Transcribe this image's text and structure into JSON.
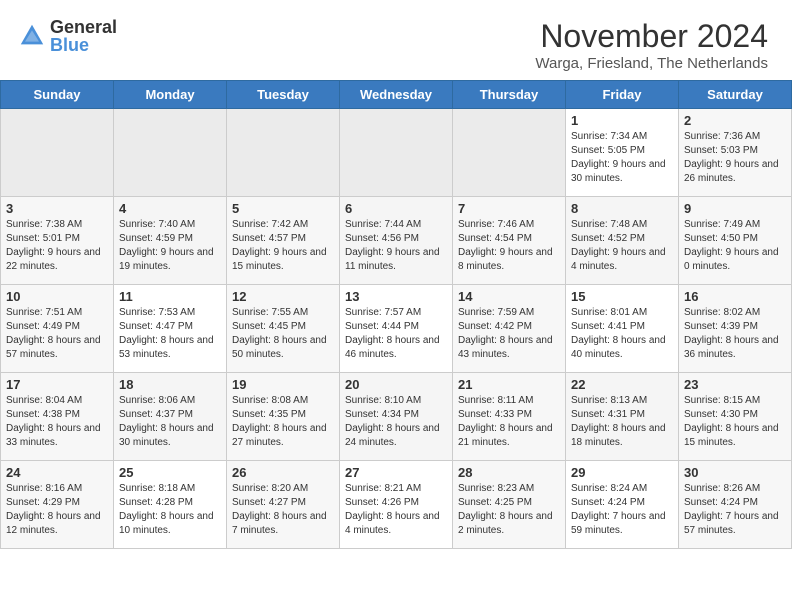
{
  "header": {
    "logo_general": "General",
    "logo_blue": "Blue",
    "title": "November 2024",
    "location": "Warga, Friesland, The Netherlands"
  },
  "days_of_week": [
    "Sunday",
    "Monday",
    "Tuesday",
    "Wednesday",
    "Thursday",
    "Friday",
    "Saturday"
  ],
  "weeks": [
    {
      "days": [
        {
          "num": "",
          "info": ""
        },
        {
          "num": "",
          "info": ""
        },
        {
          "num": "",
          "info": ""
        },
        {
          "num": "",
          "info": ""
        },
        {
          "num": "",
          "info": ""
        },
        {
          "num": "1",
          "info": "Sunrise: 7:34 AM\nSunset: 5:05 PM\nDaylight: 9 hours and 30 minutes."
        },
        {
          "num": "2",
          "info": "Sunrise: 7:36 AM\nSunset: 5:03 PM\nDaylight: 9 hours and 26 minutes."
        }
      ]
    },
    {
      "days": [
        {
          "num": "3",
          "info": "Sunrise: 7:38 AM\nSunset: 5:01 PM\nDaylight: 9 hours and 22 minutes."
        },
        {
          "num": "4",
          "info": "Sunrise: 7:40 AM\nSunset: 4:59 PM\nDaylight: 9 hours and 19 minutes."
        },
        {
          "num": "5",
          "info": "Sunrise: 7:42 AM\nSunset: 4:57 PM\nDaylight: 9 hours and 15 minutes."
        },
        {
          "num": "6",
          "info": "Sunrise: 7:44 AM\nSunset: 4:56 PM\nDaylight: 9 hours and 11 minutes."
        },
        {
          "num": "7",
          "info": "Sunrise: 7:46 AM\nSunset: 4:54 PM\nDaylight: 9 hours and 8 minutes."
        },
        {
          "num": "8",
          "info": "Sunrise: 7:48 AM\nSunset: 4:52 PM\nDaylight: 9 hours and 4 minutes."
        },
        {
          "num": "9",
          "info": "Sunrise: 7:49 AM\nSunset: 4:50 PM\nDaylight: 9 hours and 0 minutes."
        }
      ]
    },
    {
      "days": [
        {
          "num": "10",
          "info": "Sunrise: 7:51 AM\nSunset: 4:49 PM\nDaylight: 8 hours and 57 minutes."
        },
        {
          "num": "11",
          "info": "Sunrise: 7:53 AM\nSunset: 4:47 PM\nDaylight: 8 hours and 53 minutes."
        },
        {
          "num": "12",
          "info": "Sunrise: 7:55 AM\nSunset: 4:45 PM\nDaylight: 8 hours and 50 minutes."
        },
        {
          "num": "13",
          "info": "Sunrise: 7:57 AM\nSunset: 4:44 PM\nDaylight: 8 hours and 46 minutes."
        },
        {
          "num": "14",
          "info": "Sunrise: 7:59 AM\nSunset: 4:42 PM\nDaylight: 8 hours and 43 minutes."
        },
        {
          "num": "15",
          "info": "Sunrise: 8:01 AM\nSunset: 4:41 PM\nDaylight: 8 hours and 40 minutes."
        },
        {
          "num": "16",
          "info": "Sunrise: 8:02 AM\nSunset: 4:39 PM\nDaylight: 8 hours and 36 minutes."
        }
      ]
    },
    {
      "days": [
        {
          "num": "17",
          "info": "Sunrise: 8:04 AM\nSunset: 4:38 PM\nDaylight: 8 hours and 33 minutes."
        },
        {
          "num": "18",
          "info": "Sunrise: 8:06 AM\nSunset: 4:37 PM\nDaylight: 8 hours and 30 minutes."
        },
        {
          "num": "19",
          "info": "Sunrise: 8:08 AM\nSunset: 4:35 PM\nDaylight: 8 hours and 27 minutes."
        },
        {
          "num": "20",
          "info": "Sunrise: 8:10 AM\nSunset: 4:34 PM\nDaylight: 8 hours and 24 minutes."
        },
        {
          "num": "21",
          "info": "Sunrise: 8:11 AM\nSunset: 4:33 PM\nDaylight: 8 hours and 21 minutes."
        },
        {
          "num": "22",
          "info": "Sunrise: 8:13 AM\nSunset: 4:31 PM\nDaylight: 8 hours and 18 minutes."
        },
        {
          "num": "23",
          "info": "Sunrise: 8:15 AM\nSunset: 4:30 PM\nDaylight: 8 hours and 15 minutes."
        }
      ]
    },
    {
      "days": [
        {
          "num": "24",
          "info": "Sunrise: 8:16 AM\nSunset: 4:29 PM\nDaylight: 8 hours and 12 minutes."
        },
        {
          "num": "25",
          "info": "Sunrise: 8:18 AM\nSunset: 4:28 PM\nDaylight: 8 hours and 10 minutes."
        },
        {
          "num": "26",
          "info": "Sunrise: 8:20 AM\nSunset: 4:27 PM\nDaylight: 8 hours and 7 minutes."
        },
        {
          "num": "27",
          "info": "Sunrise: 8:21 AM\nSunset: 4:26 PM\nDaylight: 8 hours and 4 minutes."
        },
        {
          "num": "28",
          "info": "Sunrise: 8:23 AM\nSunset: 4:25 PM\nDaylight: 8 hours and 2 minutes."
        },
        {
          "num": "29",
          "info": "Sunrise: 8:24 AM\nSunset: 4:24 PM\nDaylight: 7 hours and 59 minutes."
        },
        {
          "num": "30",
          "info": "Sunrise: 8:26 AM\nSunset: 4:24 PM\nDaylight: 7 hours and 57 minutes."
        }
      ]
    }
  ]
}
